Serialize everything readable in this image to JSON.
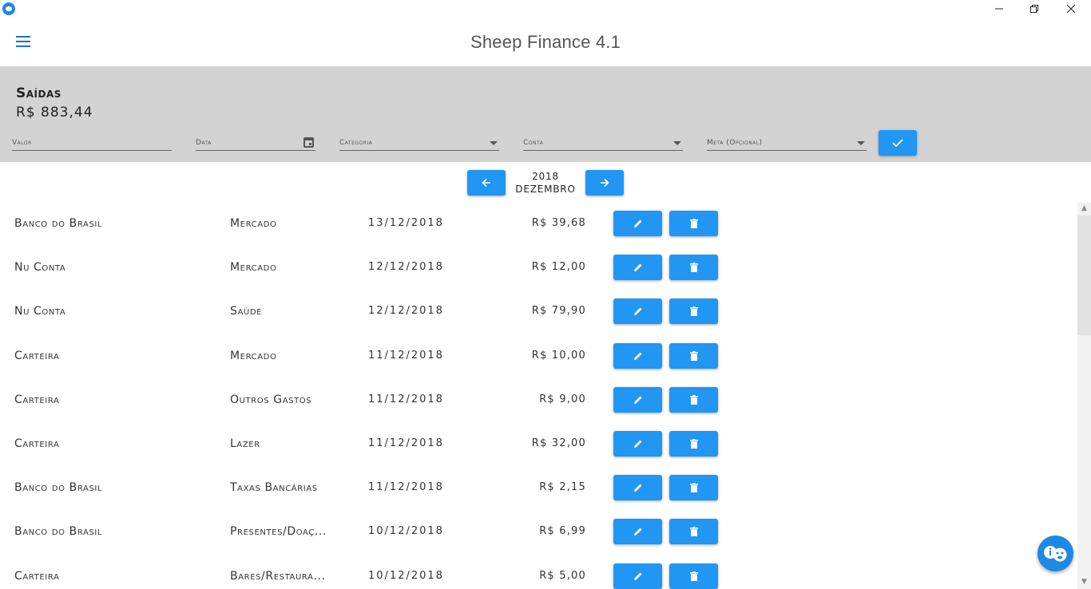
{
  "window": {
    "minimize_icon": "minimize-icon",
    "restore_icon": "restore-icon",
    "close_icon": "close-icon"
  },
  "header": {
    "title": "Sheep Finance 4.1",
    "menu_icon": "hamburger-menu-icon"
  },
  "summary": {
    "title": "Saídas",
    "total": "R$ 883,44"
  },
  "form": {
    "valor_placeholder": "Valor",
    "data_placeholder": "Data",
    "categoria_placeholder": "Categoria",
    "conta_placeholder": "Conta",
    "meta_placeholder": "Meta (Opcional)",
    "confirm_icon": "check-icon"
  },
  "period": {
    "year": "2018",
    "month": "DEZEMBRO",
    "prev_icon": "arrow-left-icon",
    "next_icon": "arrow-right-icon"
  },
  "transactions": [
    {
      "account": "Banco do Brasil",
      "category": "Mercado",
      "date": "13/12/2018",
      "value": "R$ 39,68"
    },
    {
      "account": "Nu Conta",
      "category": "Mercado",
      "date": "12/12/2018",
      "value": "R$ 12,00"
    },
    {
      "account": "Nu Conta",
      "category": "Saúde",
      "date": "12/12/2018",
      "value": "R$ 79,90"
    },
    {
      "account": "Carteira",
      "category": "Mercado",
      "date": "11/12/2018",
      "value": "R$ 10,00"
    },
    {
      "account": "Carteira",
      "category": "Outros Gastos",
      "date": "11/12/2018",
      "value": "R$ 9,00"
    },
    {
      "account": "Carteira",
      "category": "Lazer",
      "date": "11/12/2018",
      "value": "R$ 32,00"
    },
    {
      "account": "Banco do Brasil",
      "category": "Taxas Bancárias",
      "date": "11/12/2018",
      "value": "R$ 2,15"
    },
    {
      "account": "Banco do Brasil",
      "category": "Presentes/Doaç...",
      "date": "10/12/2018",
      "value": "R$ 6,99"
    },
    {
      "account": "Carteira",
      "category": "Bares/Restaura...",
      "date": "10/12/2018",
      "value": "R$ 5,00"
    }
  ],
  "row_actions": {
    "edit_icon": "pencil-icon",
    "delete_icon": "trash-icon"
  },
  "fab": {
    "icon": "info-sheep-icon"
  },
  "colors": {
    "accent": "#2196f3",
    "panel": "#d3d3d3"
  }
}
